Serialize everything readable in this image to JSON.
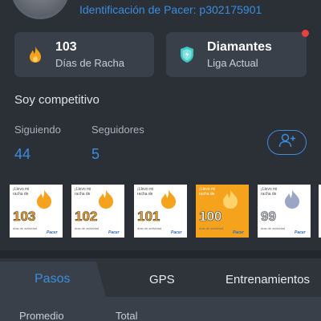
{
  "profile": {
    "pacer_id": "Identificación de Pacer: p302175901",
    "bio": "Soy competitivo"
  },
  "stats": {
    "streak": {
      "value": "103",
      "label": "Días de Racha",
      "icon": "flame-icon"
    },
    "league": {
      "value": "Diamantes",
      "label": "Liga Actual",
      "icon": "diamond-shield-icon",
      "notification": true
    }
  },
  "follow": {
    "following_label": "Siguiendo",
    "following_count": "44",
    "followers_label": "Seguidores",
    "followers_count": "5",
    "add_friend_icon": "add-user-icon"
  },
  "badges": [
    {
      "number": "103",
      "header": "¡Llevo mi racha de",
      "sub": "días de actividad",
      "brand": "Pacer",
      "style": "white"
    },
    {
      "number": "102",
      "header": "¡Llevo mi racha de",
      "sub": "días de actividad",
      "brand": "Pacer",
      "style": "white"
    },
    {
      "number": "101",
      "header": "¡Llevo mi racha de",
      "sub": "días de actividad",
      "brand": "Pacer",
      "style": "white"
    },
    {
      "number": "100",
      "header": "¡Llevo mi racha de",
      "sub": "días de actividad",
      "brand": "Pacer",
      "style": "orange"
    },
    {
      "number": "99",
      "header": "¡Llevo mi racha de",
      "sub": "días de actividad",
      "brand": "Pacer",
      "style": "gray"
    }
  ],
  "tabs": [
    {
      "label": "Pasos",
      "active": true
    },
    {
      "label": "GPS",
      "active": false
    },
    {
      "label": "Entrenamientos",
      "active": false
    }
  ],
  "summary": {
    "average_label": "Promedio",
    "total_label": "Total"
  },
  "colors": {
    "background": "#2b2f36",
    "card": "#3a404a",
    "accent": "#3a8ee0",
    "flame": "#f5a21c",
    "diamond": "#3ec7c4",
    "notification": "#e8433b"
  }
}
